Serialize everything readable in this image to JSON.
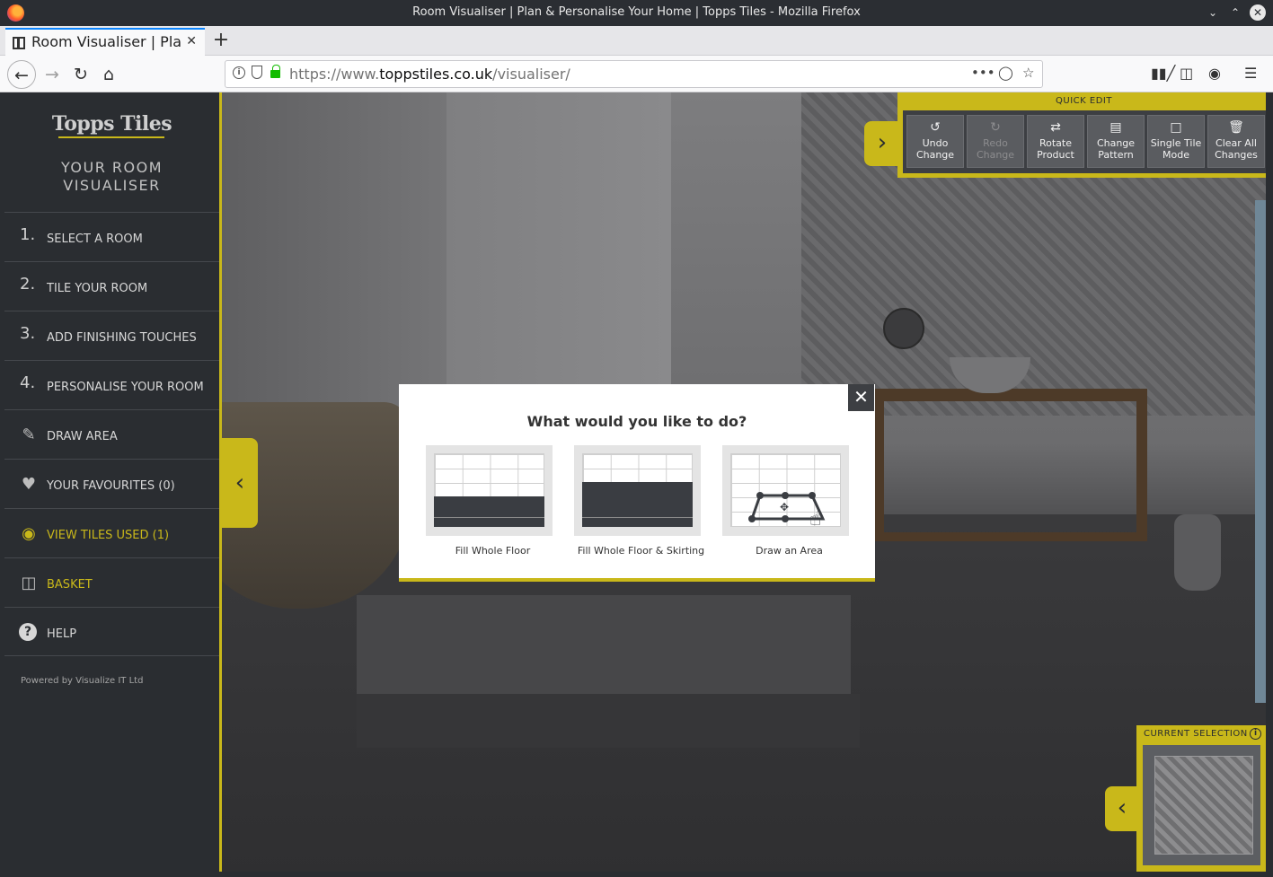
{
  "window": {
    "title": "Room Visualiser | Plan & Personalise Your Home | Topps Tiles - Mozilla Firefox"
  },
  "tab": {
    "title": "Room Visualiser | Plan & Personalise Your Home"
  },
  "urlbar": {
    "url_prefix": "https://www.",
    "url_domain": "toppstiles.co.uk",
    "url_path": "/visualiser/"
  },
  "sidebar": {
    "logo": "Topps Tiles",
    "tagline_line1": "YOUR ROOM",
    "tagline_line2": "VISUALISER",
    "items": [
      {
        "num": "1.",
        "label": "SELECT A ROOM"
      },
      {
        "num": "2.",
        "label": "TILE YOUR ROOM"
      },
      {
        "num": "3.",
        "label": "ADD FINISHING TOUCHES"
      },
      {
        "num": "4.",
        "label": "PERSONALISE YOUR ROOM"
      },
      {
        "icon": "pencil-icon",
        "label": "DRAW AREA"
      },
      {
        "icon": "heart-icon",
        "label": "YOUR FAVOURITES (0)"
      },
      {
        "icon": "eye-icon",
        "label": "VIEW TILES USED (1)"
      },
      {
        "icon": "basket-icon",
        "label": "BASKET"
      },
      {
        "icon": "help-icon",
        "label": "HELP"
      }
    ],
    "powered_by": "Powered by Visualize IT Ltd"
  },
  "quick_edit": {
    "title": "QUICK EDIT",
    "buttons": [
      {
        "line1": "Undo",
        "line2": "Change",
        "icon": "undo-icon",
        "enabled": true
      },
      {
        "line1": "Redo",
        "line2": "Change",
        "icon": "redo-icon",
        "enabled": false
      },
      {
        "line1": "Rotate",
        "line2": "Product",
        "icon": "rotate-icon",
        "enabled": true
      },
      {
        "line1": "Change",
        "line2": "Pattern",
        "icon": "pattern-icon",
        "enabled": true
      },
      {
        "line1": "Single Tile",
        "line2": "Mode",
        "icon": "square-icon",
        "enabled": true
      },
      {
        "line1": "Clear All",
        "line2": "Changes",
        "icon": "trash-icon",
        "enabled": true
      }
    ]
  },
  "current_selection": {
    "title": "CURRENT SELECTION",
    "info": "i"
  },
  "modal": {
    "title": "What would you like to do?",
    "options": [
      {
        "label": "Fill Whole Floor"
      },
      {
        "label": "Fill Whole Floor & Skirting"
      },
      {
        "label": "Draw an Area"
      }
    ]
  },
  "colors": {
    "accent": "#c9b81a",
    "sidebar_bg": "#2a2d31",
    "panel_dark": "#3d3f43"
  }
}
